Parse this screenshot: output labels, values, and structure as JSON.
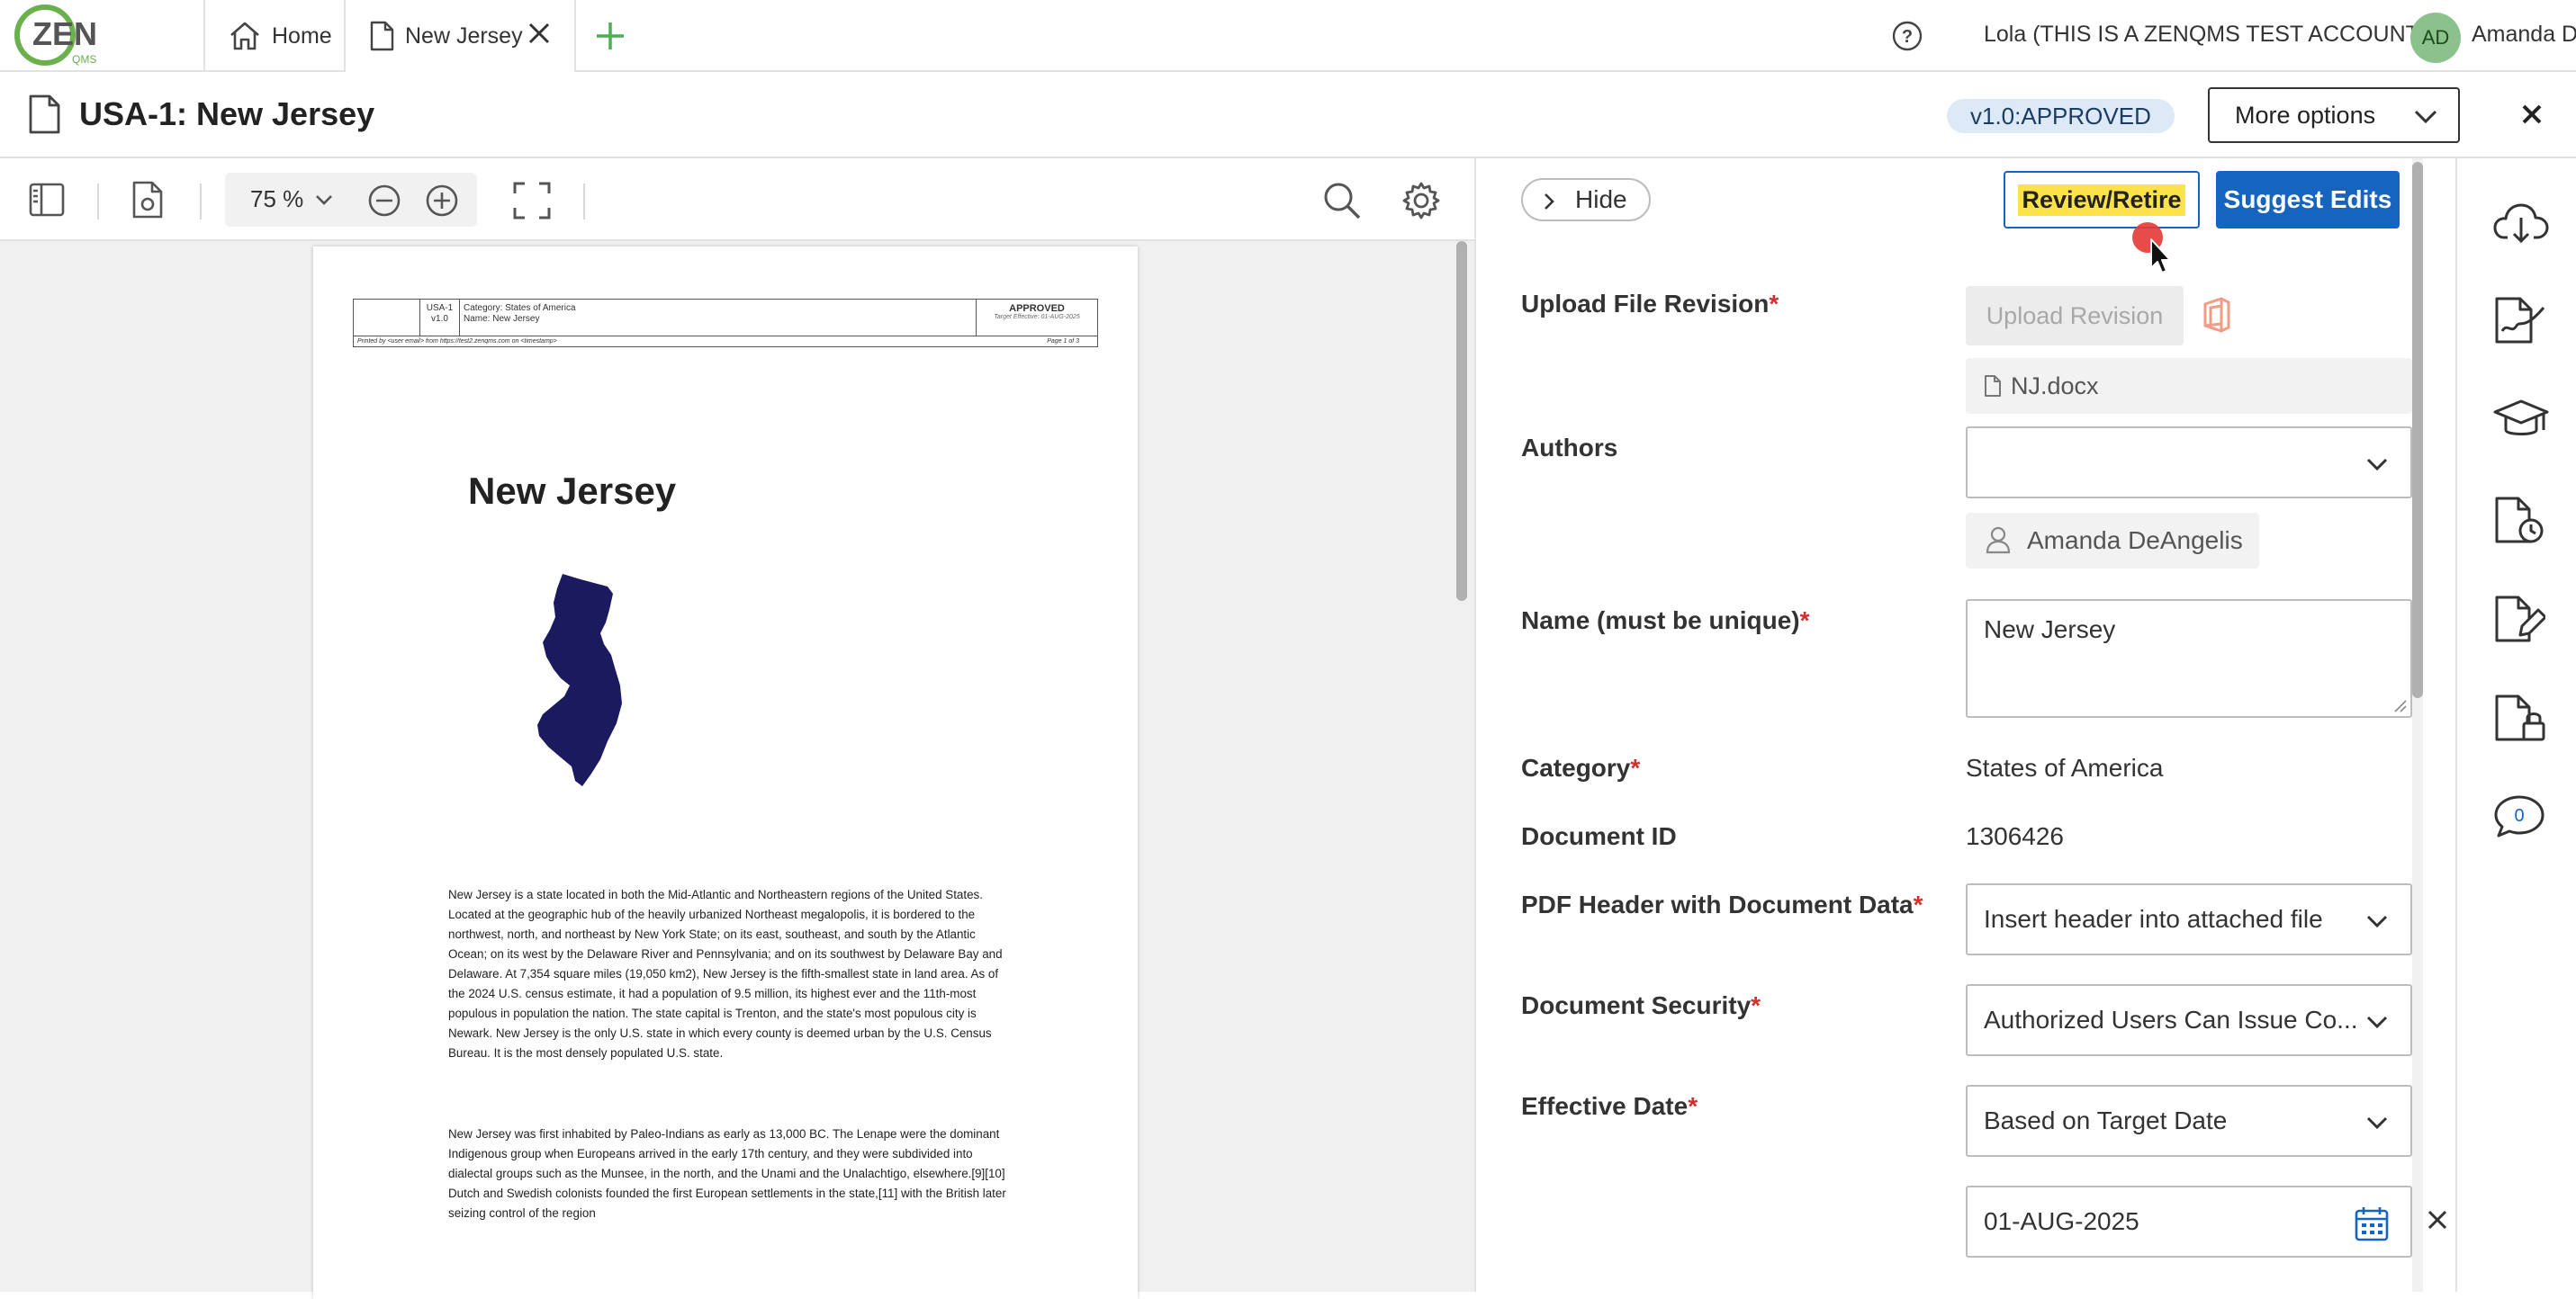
{
  "topbar": {
    "logo_text": "ZEN",
    "logo_sub": "QMS",
    "tabs": [
      {
        "label": "Home",
        "icon": "home-icon"
      },
      {
        "label": "New Jersey",
        "icon": "document-icon"
      }
    ],
    "account_label": "Lola (THIS IS A ZENQMS TEST ACCOUNT)",
    "avatar_initials": "AD",
    "user_name": "Amanda D"
  },
  "titlebar": {
    "title": "USA-1: New Jersey",
    "version_badge": "v1.0:APPROVED",
    "more_options_label": "More options"
  },
  "viewer": {
    "zoom": "75 %",
    "pdf": {
      "header": {
        "doc_id": "USA-1",
        "version": "v1.0",
        "category_line": "Category: States of America",
        "name_line": "Name: New Jersey",
        "status": "APPROVED",
        "target_effective": "Target Effective: 01-AUG-2025",
        "printed_by": "Printed by <user email> from https://test2.zenqms.com on <timestamp>",
        "page_label": "Page 1 of 3"
      },
      "title": "New Jersey",
      "paragraph1": "New Jersey is a state located in both the Mid-Atlantic and Northeastern regions of the United States. Located at the geographic hub of the heavily urbanized Northeast megalopolis, it is bordered to the northwest, north, and northeast by New York State; on its east, southeast, and south by the Atlantic Ocean; on its west by the Delaware River and Pennsylvania; and on its southwest by Delaware Bay and Delaware. At 7,354 square miles (19,050 km2), New Jersey is the fifth-smallest state in land area. As of the 2024 U.S. census estimate, it had a population of 9.5 million, its highest ever and the 11th-most populous in population the nation. The state capital is Trenton, and the state's most populous city is Newark. New Jersey is the only U.S. state in which every county is deemed urban by the U.S. Census Bureau. It is the most densely populated U.S. state.",
      "paragraph2": "New Jersey was first inhabited by Paleo-Indians as early as 13,000 BC. The Lenape were the dominant Indigenous group when Europeans arrived in the early 17th century, and they were subdivided into dialectal groups such as the Munsee, in the north, and the Unami and the Unalachtigo, elsewhere.[9][10] Dutch and Swedish colonists founded the first European settlements in the state,[11] with the British later seizing control of the region"
    }
  },
  "form": {
    "hide_label": "Hide",
    "review_label": "Review/Retire",
    "suggest_label": "Suggest Edits",
    "upload_label": "Upload File Revision",
    "upload_button": "Upload Revision",
    "file_name": "NJ.docx",
    "authors_label": "Authors",
    "authors_value": "",
    "author_chip": "Amanda DeAngelis",
    "name_label": "Name (must be unique)",
    "name_value": "New Jersey",
    "category_label": "Category",
    "category_value": "States of America",
    "docid_label": "Document ID",
    "docid_value": "1306426",
    "pdf_header_label": "PDF Header with Document Data",
    "pdf_header_value": "Insert header into attached file",
    "security_label": "Document Security",
    "security_value": "Authorized Users Can Issue Co...",
    "effective_label": "Effective Date",
    "effective_value": "Based on Target Date",
    "date_value": "01-AUG-2025",
    "required_mark": "*"
  },
  "rail": {
    "icons": [
      "cloud-download-icon",
      "signature-document-icon",
      "training-icon",
      "history-document-icon",
      "edit-document-icon",
      "locked-document-icon",
      "comments-icon"
    ],
    "comments_count": "0"
  },
  "colors": {
    "primary": "#1565c0",
    "highlight": "#fde24a",
    "required": "#d32f2f",
    "badge_bg": "#dde9f7",
    "avatar_bg": "#8bc18b",
    "logo_green": "#6ab04c",
    "state_fill": "#1c1a5e"
  }
}
